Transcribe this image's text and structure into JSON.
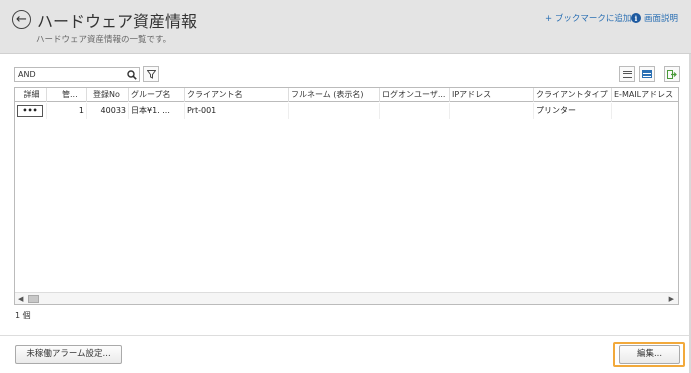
{
  "header": {
    "title": "ハードウェア資産情報",
    "subtitle": "ハードウェア資産情報の一覧です。",
    "bookmark_label": "+ ブックマークに追加",
    "help_label": "画面説明",
    "help_icon": "i"
  },
  "toolbar": {
    "search_value": "AND",
    "search_placeholder": "",
    "search_icon": "search-icon",
    "filter_icon": "filter-icon",
    "view_list_icon": "list-view-icon",
    "view_grid_icon": "grid-view-icon",
    "export_icon": "export-icon"
  },
  "table": {
    "columns": [
      "詳細",
      "管...",
      "登録No",
      "グループ名",
      "クライアント名",
      "フルネーム (表示名)",
      "ログオンユーザ...",
      "IPアドレス",
      "クライアントタイプ",
      "E-MAILアドレス"
    ],
    "rows": [
      {
        "detail": "•••",
        "kan": "1",
        "reg_no": "40033",
        "group": "日本¥1. ...",
        "client": "Prt-001",
        "fullname": "",
        "logon": "",
        "ip": "",
        "client_type": "プリンター",
        "email": ""
      }
    ]
  },
  "footer": {
    "count": "1 個",
    "alarm_button": "未稼働アラーム設定...",
    "edit_button": "編集..."
  }
}
